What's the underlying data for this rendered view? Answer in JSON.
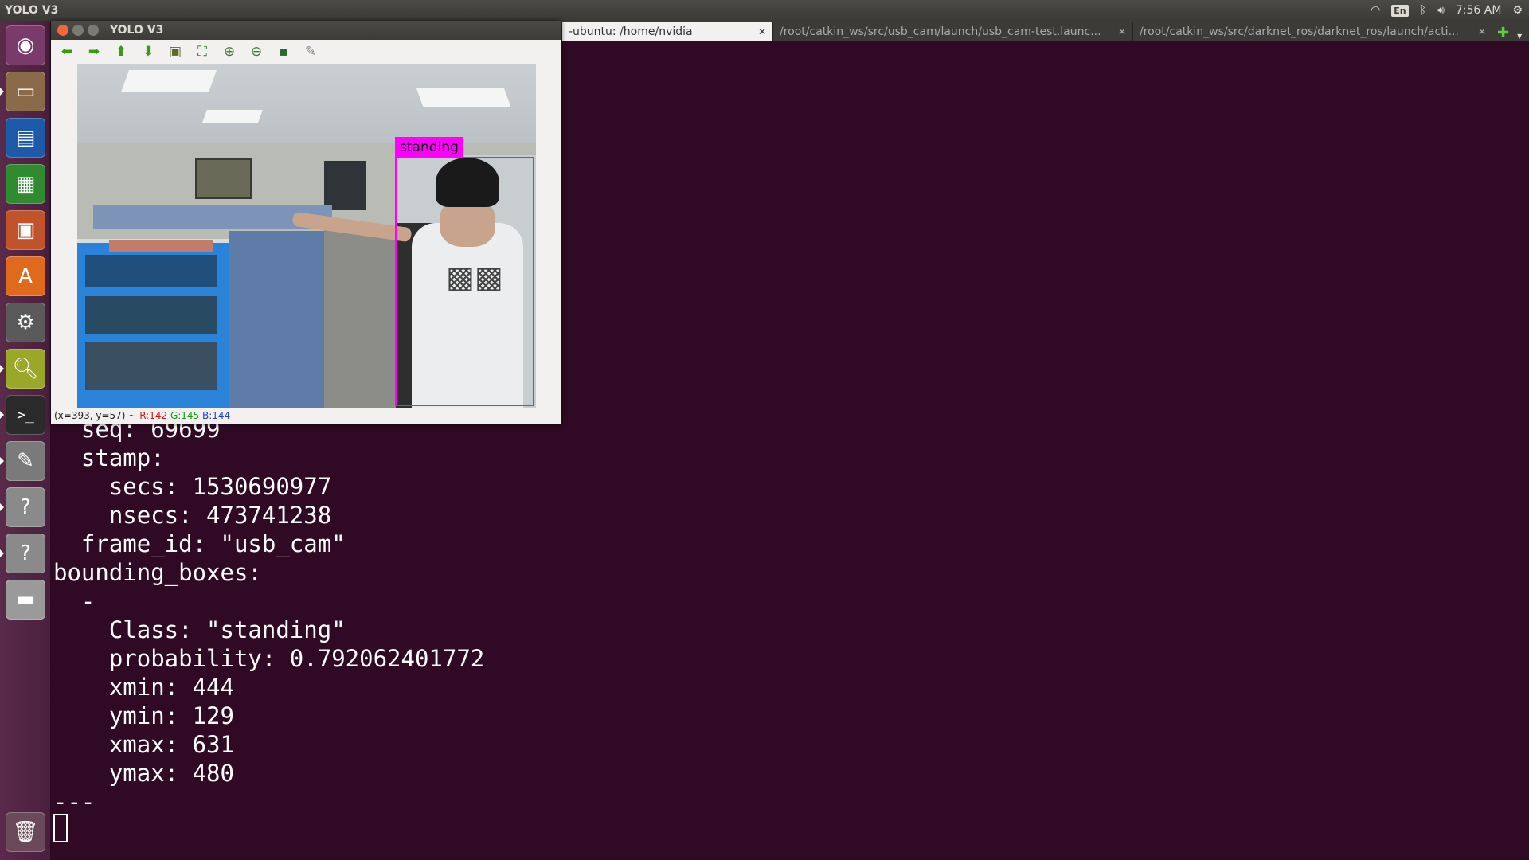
{
  "top_panel": {
    "app_title": "YOLO V3",
    "keyboard_layout": "En",
    "clock": "7:56 AM"
  },
  "launcher": {
    "items": [
      {
        "name": "ubuntu-dash-icon",
        "color": "#7a3a6a"
      },
      {
        "name": "files-icon",
        "color": "#8a6a48"
      },
      {
        "name": "writer-icon",
        "color": "#1e5aa8"
      },
      {
        "name": "calc-icon",
        "color": "#2f8a30"
      },
      {
        "name": "impress-icon",
        "color": "#c0532a"
      },
      {
        "name": "software-center-icon",
        "color": "#e06a1c"
      },
      {
        "name": "system-settings-icon",
        "color": "#5a5a5a"
      },
      {
        "name": "image-viewer-icon",
        "color": "#9aa82a"
      },
      {
        "name": "terminal-icon",
        "color": "#2b2b2b"
      },
      {
        "name": "text-editor-icon",
        "color": "#7a7a7a"
      },
      {
        "name": "unknown-app-icon",
        "color": "#8a8a8a"
      },
      {
        "name": "unknown-app-icon-2",
        "color": "#8a8a8a"
      },
      {
        "name": "drive-icon",
        "color": "#9a9a9a"
      }
    ],
    "trash": {
      "name": "trash-icon"
    }
  },
  "terminal_tabs": [
    {
      "label": "-ubuntu: /home/nvidia",
      "active": true
    },
    {
      "label": "/root/catkin_ws/src/usb_cam/launch/usb_cam-test.launc...",
      "active": false
    },
    {
      "label": "/root/catkin_ws/src/darknet_ros/darknet_ros/launch/acti...",
      "active": false
    }
  ],
  "terminal_lines": [
    "  seq: 69699",
    "  stamp: ",
    "    secs: 1530690977",
    "    nsecs: 473741238",
    "  frame_id: \"usb_cam\"",
    "bounding_boxes: ",
    "  - ",
    "    Class: \"standing\"",
    "    probability: 0.792062401772",
    "    xmin: 444",
    "    ymin: 129",
    "    xmax: 631",
    "    ymax: 480",
    "---"
  ],
  "yolo_window": {
    "title": "YOLO V3",
    "toolbar_icons": [
      "arrow-left-icon",
      "arrow-right-icon",
      "arrow-up-icon",
      "arrow-down-icon",
      "save-image-icon",
      "zoom-fit-icon",
      "zoom-in-icon",
      "zoom-out-icon",
      "save-icon",
      "properties-icon"
    ],
    "detection_label": "standing",
    "detection_color": "#ff00ff",
    "status": {
      "coords": "(x=393, y=57) ~",
      "r": "R:142",
      "g": "G:145",
      "b": "B:144"
    }
  }
}
